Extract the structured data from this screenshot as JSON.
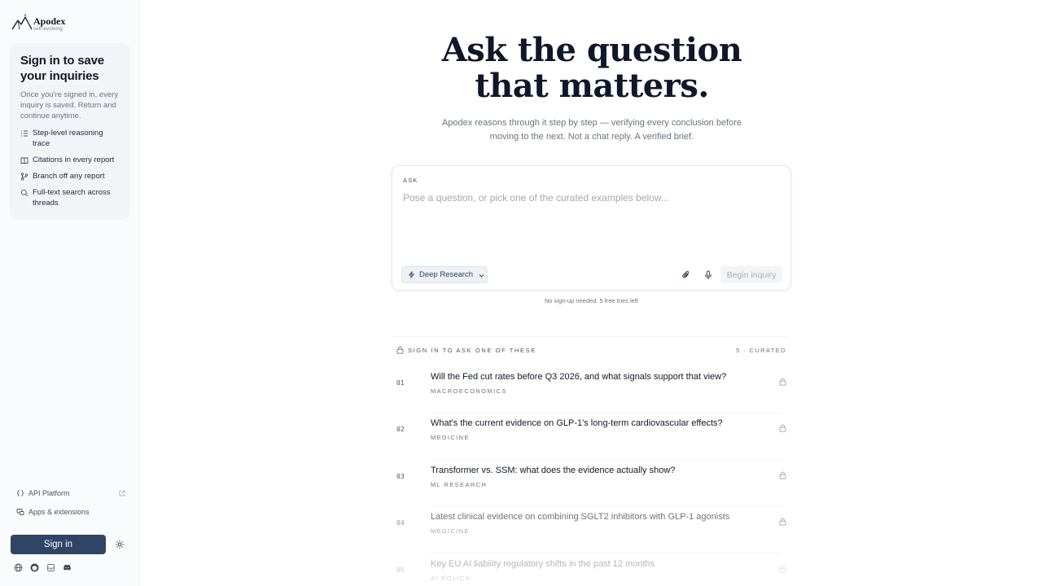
{
  "brand": {
    "name": "Apodex",
    "tagline": "self-evolving"
  },
  "sidebar": {
    "card": {
      "title": "Sign in to save your inquiries",
      "description": "Once you're signed in, every inquiry is saved. Return and continue anytime.",
      "features": [
        {
          "icon": "list-steps-icon",
          "label": "Step-level reasoning trace"
        },
        {
          "icon": "book-icon",
          "label": "Citations in every report"
        },
        {
          "icon": "branch-icon",
          "label": "Branch off any report"
        },
        {
          "icon": "search-icon",
          "label": "Full-text search across threads"
        }
      ]
    },
    "links": [
      {
        "icon": "code-braces-icon",
        "label": "API Platform"
      },
      {
        "icon": "apps-icon",
        "label": "Apps & extensions"
      }
    ],
    "signin_label": "Sign in",
    "social": [
      "globe-icon",
      "github-icon",
      "archive-icon",
      "discord-icon"
    ]
  },
  "hero": {
    "title_line1": "Ask the question",
    "title_line2": "that matters.",
    "subtitle": "Apodex reasons through it step by step — verifying every conclusion before moving to the next. Not a chat reply. A verified brief."
  },
  "ask": {
    "label": "ASK",
    "placeholder": "Pose a question, or pick one of the curated examples below...",
    "value": "",
    "mode_label": "Deep Research",
    "begin_label": "Begin inquiry",
    "tries_note": "No sign-up needed. 5 free tries left"
  },
  "curated": {
    "heading": "SIGN IN TO ASK ONE OF THESE",
    "count_label": "5 · CURATED",
    "items": [
      {
        "num": "01",
        "question": "Will the Fed cut rates before Q3 2026, and what signals support that view?",
        "category": "MACROECONOMICS"
      },
      {
        "num": "02",
        "question": "What's the current evidence on GLP-1's long-term cardiovascular effects?",
        "category": "MEDICINE"
      },
      {
        "num": "03",
        "question": "Transformer vs. SSM: what does the evidence actually show?",
        "category": "ML RESEARCH"
      },
      {
        "num": "04",
        "question": "Latest clinical evidence on combining SGLT2 inhibitors with GLP-1 agonists",
        "category": "MEDICINE"
      },
      {
        "num": "05",
        "question": "Key EU AI liability regulatory shifts in the past 12 months",
        "category": "AI POLICY"
      }
    ]
  },
  "colors": {
    "primary": "#304565",
    "text": "#111827",
    "muted": "#6b7280",
    "sidebar_bg": "#fafbfc"
  }
}
